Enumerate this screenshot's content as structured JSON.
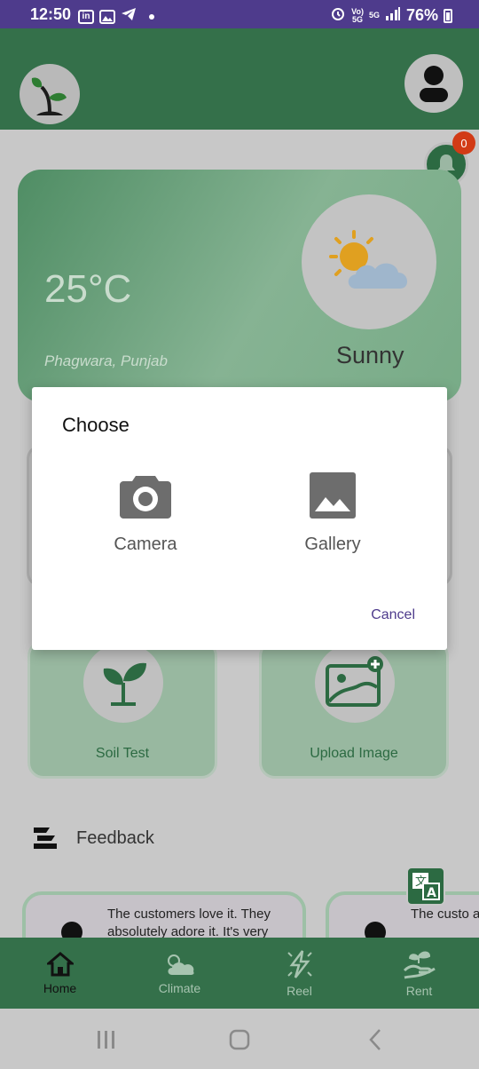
{
  "status_bar": {
    "time": "12:50",
    "left_icons": [
      "linkedin-icon",
      "gallery-icon",
      "telegram-icon"
    ],
    "network_small_1": "Vo)\n5G",
    "network_small_2": "5G",
    "battery": "76%"
  },
  "app_bar": {
    "logo_icon": "sprout-logo-icon",
    "profile_icon": "user-profile-icon"
  },
  "notifications": {
    "count": "0"
  },
  "weather": {
    "temperature": "25°C",
    "location": "Phagwara, Punjab",
    "condition": "Sunny",
    "icon": "sun-cloud-icon"
  },
  "tiles": [
    {
      "label": "Soil Test",
      "icon": "plant-icon"
    },
    {
      "label": "Upload Image",
      "icon": "image-add-icon"
    }
  ],
  "feedback": {
    "title": "Feedback",
    "reviews": [
      {
        "text": "The customers love it. They absolutely adore it. It's very"
      },
      {
        "text": "The custo absolutel"
      }
    ]
  },
  "bottom_nav": [
    {
      "label": "Home",
      "icon": "home-icon",
      "active": true
    },
    {
      "label": "Climate",
      "icon": "cloud-sun-icon",
      "active": false
    },
    {
      "label": "Reel",
      "icon": "lightning-icon",
      "active": false
    },
    {
      "label": "Rent",
      "icon": "hand-plant-icon",
      "active": false
    }
  ],
  "dialog": {
    "title": "Choose",
    "options": [
      {
        "label": "Camera",
        "icon": "camera-icon"
      },
      {
        "label": "Gallery",
        "icon": "image-icon"
      }
    ],
    "cancel_label": "Cancel"
  },
  "colors": {
    "primary_green": "#34704a",
    "status_bar": "#4e3b8c",
    "accent_purple": "#4e3b8c",
    "badge_red": "#d23b16"
  }
}
